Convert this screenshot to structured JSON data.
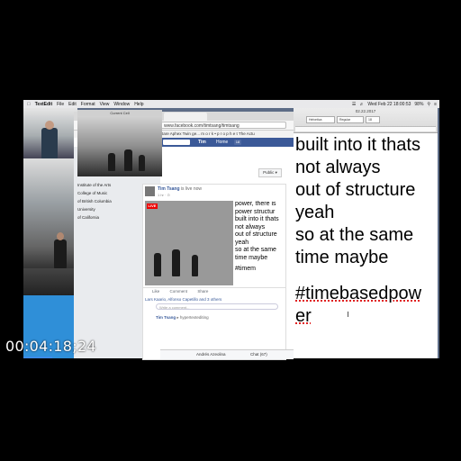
{
  "menubar": {
    "app": "TextEdit",
    "items": [
      "File",
      "Edit",
      "Format",
      "View",
      "Window",
      "Help"
    ],
    "clock": "Wed Feb 22 18:00:53",
    "battery": "98%"
  },
  "camera_window": {
    "title": "Current Cell"
  },
  "browser": {
    "url": "www.facebook.com/timtsang/timtsang",
    "bookmarks": "Rare Aphex Twin ge...  m o r k • p r o p h e t  The Actu",
    "fb": {
      "user": "Tim",
      "home": "Home",
      "home_count": "18",
      "public_button": "Public ▾",
      "sidebar": [
        "Institute of the Arts",
        "College of Music",
        "of British Columbia",
        "University",
        "of California"
      ],
      "post": {
        "author": "Tim Tsang",
        "author_suffix": "is live now",
        "time": "1 hr · ⊙",
        "live_badge": "LIVE",
        "mirror_lines": [
          "power, there is",
          "power structur",
          "built into it thats",
          "not always",
          "out of structure",
          "yeah",
          "so at the same",
          "time maybe",
          "",
          "#timem"
        ],
        "actions": [
          "Like",
          "Comment",
          "Share"
        ],
        "reactions": "Lars Kaario, Alfonso Capetillo and 3 others",
        "comment_placeholder": "Write a comment...",
        "second_author": "Tim Tsang",
        "second_suffix": "▸ hypertextediting"
      },
      "chat": {
        "contact": "Andrés Azeolina",
        "chat": "Chat (67)"
      }
    }
  },
  "textedit": {
    "title": "02.22.2017",
    "controls": [
      "Helvetica",
      "Regular",
      "18"
    ],
    "lines": [
      "built into it thats",
      "not always",
      "out of structure",
      "yeah",
      "so at the same",
      "time maybe"
    ],
    "hashtag_line1": "#timebasedpow",
    "hashtag_line2": "er"
  },
  "video": {
    "timecode": "00:04:18;24",
    "progress": 0.07
  }
}
